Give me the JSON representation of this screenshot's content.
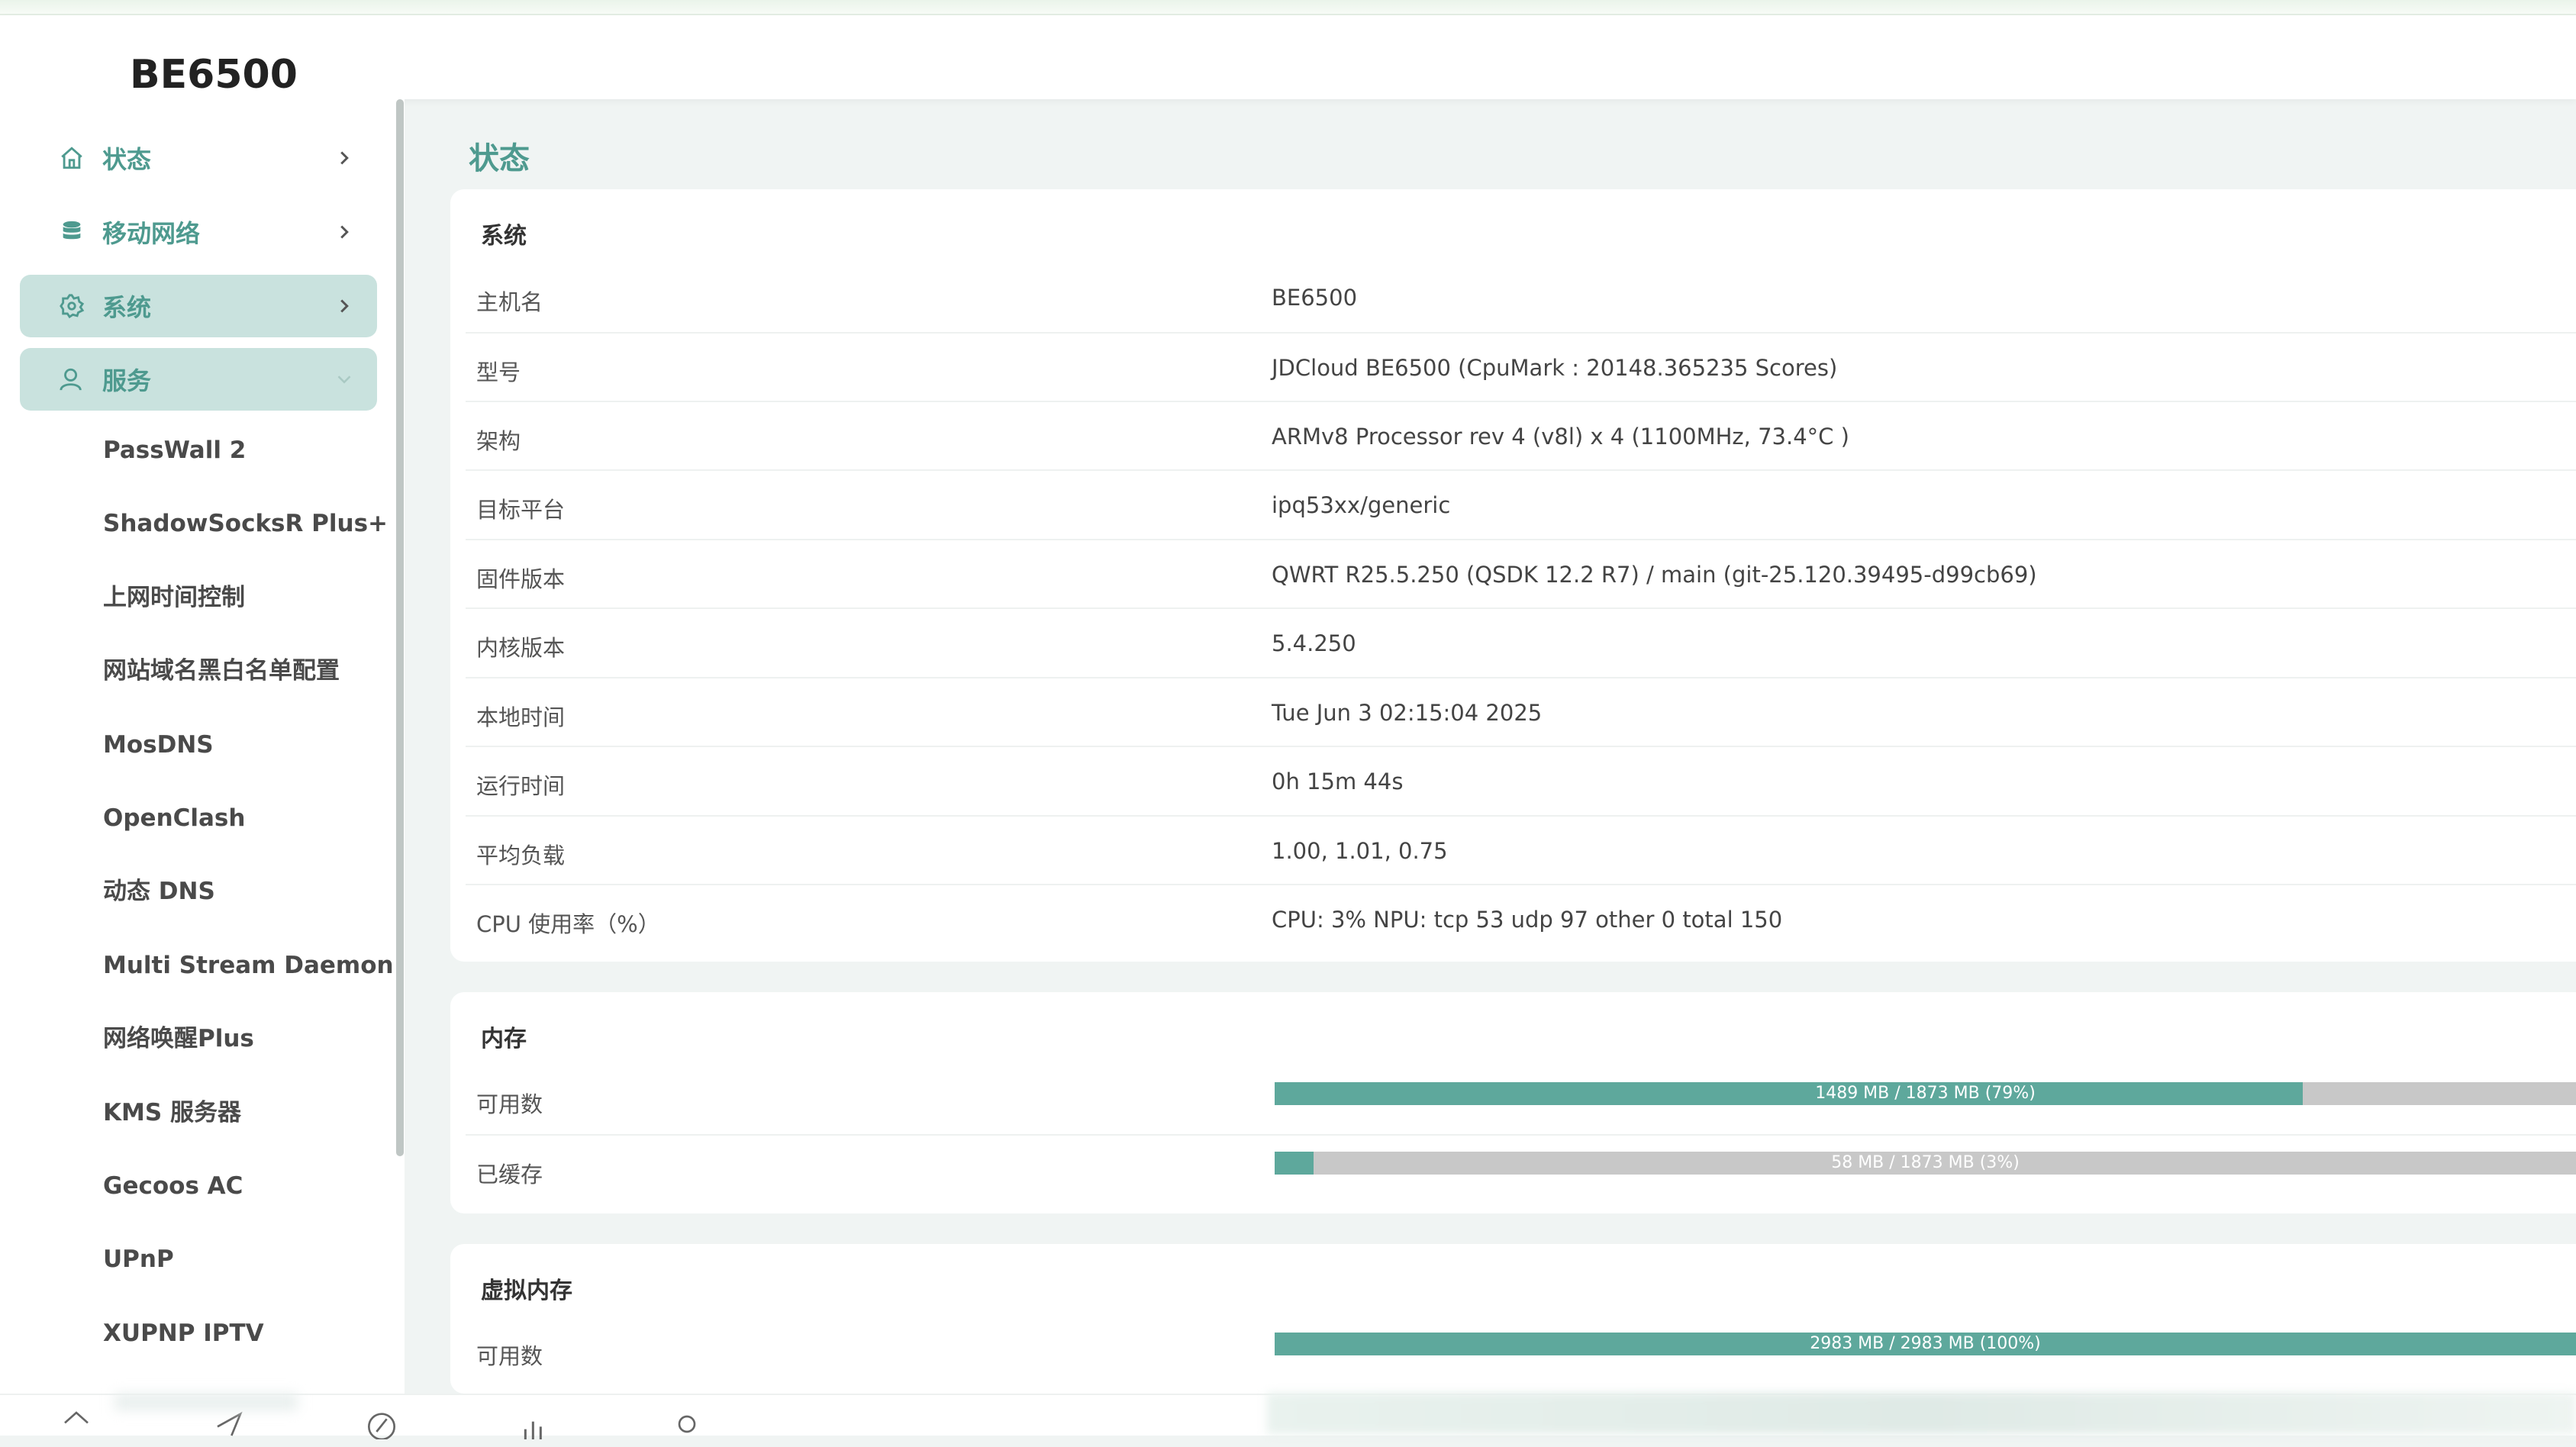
{
  "app": {
    "title": "BE6500"
  },
  "sidebar": {
    "top_items": [
      {
        "label": "状态",
        "icon": "home-icon",
        "state": "collapsed"
      },
      {
        "label": "移动网络",
        "icon": "database-icon",
        "state": "collapsed"
      },
      {
        "label": "系统",
        "icon": "gear-icon",
        "state": "collapsed"
      },
      {
        "label": "服务",
        "icon": "user-icon",
        "state": "expanded"
      }
    ],
    "service_items": [
      "PassWall 2",
      "ShadowSocksR Plus+",
      "上网时间控制",
      "网站域名黑白名单配置",
      "MosDNS",
      "OpenClash",
      "动态 DNS",
      "Multi Stream Daemon",
      "网络唤醒Plus",
      "KMS 服务器",
      "Gecoos AC",
      "UPnP",
      "XUPNP IPTV"
    ]
  },
  "main": {
    "title": "状态",
    "system": {
      "title": "系统",
      "rows": [
        {
          "key": "主机名",
          "value": "BE6500"
        },
        {
          "key": "型号",
          "value": "JDCloud BE6500 (CpuMark : 20148.365235 Scores)"
        },
        {
          "key": "架构",
          "value": "ARMv8 Processor rev 4 (v8l) x 4 (1100MHz, 73.4°C )"
        },
        {
          "key": "目标平台",
          "value": "ipq53xx/generic"
        },
        {
          "key": "固件版本",
          "value": "QWRT R25.5.250 (QSDK 12.2 R7) / main (git-25.120.39495-d99cb69)"
        },
        {
          "key": "内核版本",
          "value": "5.4.250"
        },
        {
          "key": "本地时间",
          "value": "Tue Jun 3 02:15:04 2025"
        },
        {
          "key": "运行时间",
          "value": "0h 15m 44s"
        },
        {
          "key": "平均负载",
          "value": "1.00, 1.01, 0.75"
        },
        {
          "key": "CPU 使用率（%）",
          "value": "CPU: 3% NPU: tcp 53 udp 97 other 0 total 150"
        }
      ]
    },
    "memory": {
      "title": "内存",
      "rows": [
        {
          "key": "可用数",
          "label": "1489 MB / 1873 MB (79%)",
          "percent": 79
        },
        {
          "key": "已缓存",
          "label": "58 MB / 1873 MB (3%)",
          "percent": 3
        }
      ]
    },
    "swap": {
      "title": "虚拟内存",
      "rows": [
        {
          "key": "可用数",
          "label": "2983 MB / 2983 MB (100%)",
          "percent": 100
        }
      ]
    }
  },
  "bottom_nav": {
    "icons": [
      "home-icon",
      "send-icon",
      "compass-icon",
      "bar-chart-icon",
      "search-icon"
    ]
  },
  "colors": {
    "accent": "#4e9a8f",
    "active_bg": "#c9e2de",
    "bar_fill": "#5ea89c",
    "bar_track": "#c8c8c8"
  }
}
